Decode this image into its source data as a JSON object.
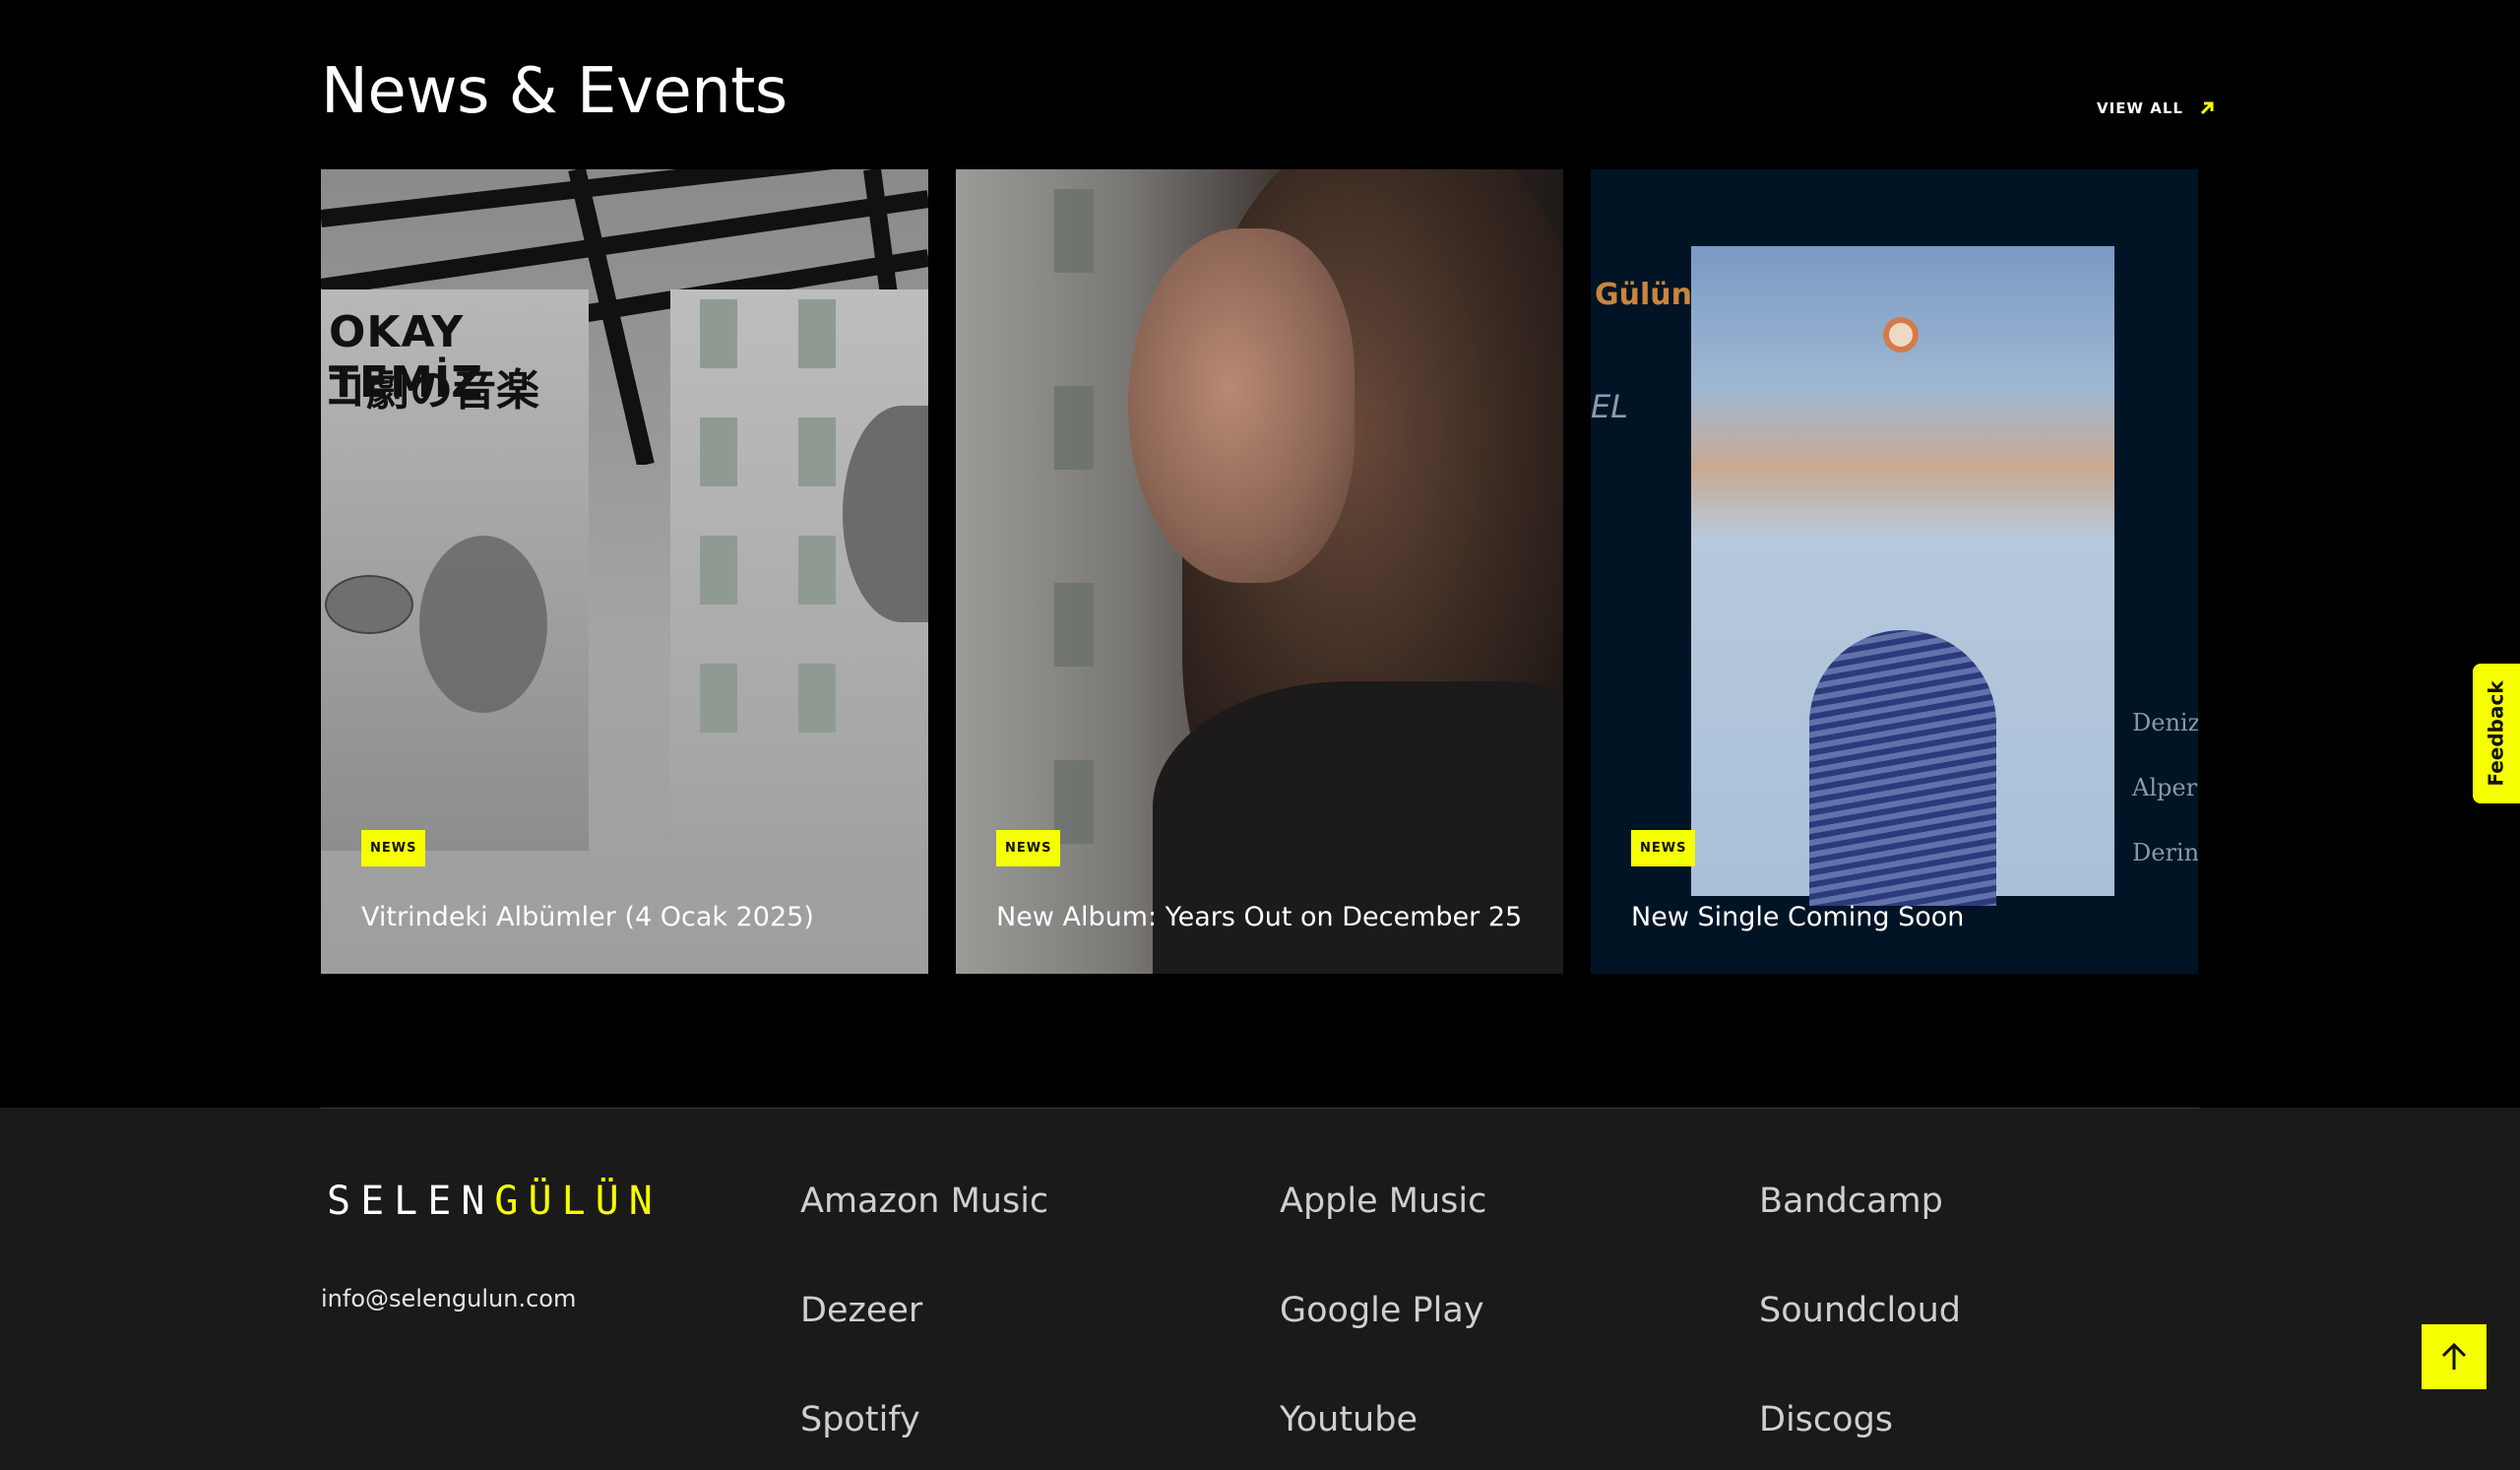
{
  "news": {
    "title": "News & Events",
    "view_all": "VIEW ALL",
    "cards": [
      {
        "tag": "NEWS",
        "title": "Vitrindeki Albümler (4 Ocak 2025)",
        "image_text_line1": "OKAY TEMİZ",
        "image_text_line2": "コ劇の音楽"
      },
      {
        "tag": "NEWS",
        "title": "New Album: Years Out on December 25"
      },
      {
        "tag": "NEWS",
        "title": "New Single Coming Soon",
        "image_artist": "Gülün",
        "image_el": "EL",
        "image_credits": [
          "Deniz",
          "Alper",
          "Derin"
        ]
      }
    ]
  },
  "feedback": "Feedback",
  "footer": {
    "logo_part1": "SELEN",
    "logo_part2": "GÜLÜN",
    "email": "info@selengulun.com",
    "links": [
      "Amazon Music",
      "Apple Music",
      "Bandcamp",
      "Dezeer",
      "Google Play",
      "Soundcloud",
      "Spotify",
      "Youtube",
      "Discogs"
    ]
  },
  "colors": {
    "accent": "#f6ff00",
    "footer_bg": "#1a1a1a",
    "page_bg": "#000000"
  },
  "icons": {
    "view_all": "arrow-up-right-icon",
    "to_top": "arrow-up-icon"
  }
}
